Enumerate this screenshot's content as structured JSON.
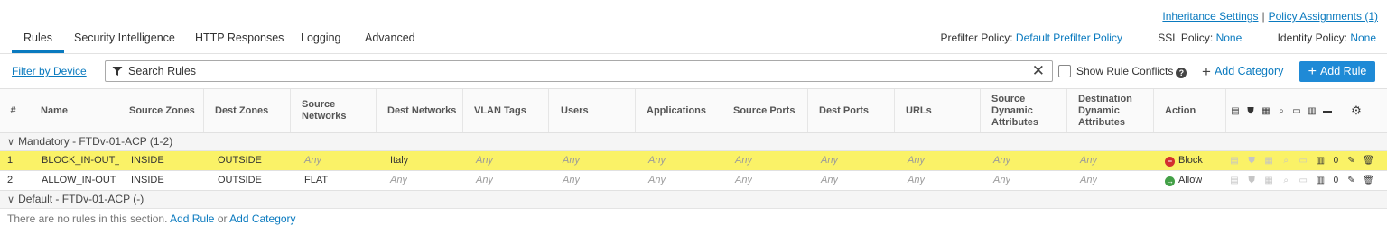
{
  "header_links": {
    "inheritance": "Inheritance Settings",
    "separator": "|",
    "assignments": "Policy Assignments (1)"
  },
  "tabs": [
    {
      "label": "Rules",
      "active": true
    },
    {
      "label": "Security Intelligence",
      "active": false
    },
    {
      "label": "HTTP Responses",
      "active": false
    },
    {
      "label": "Logging",
      "active": false
    },
    {
      "label": "Advanced",
      "active": false
    }
  ],
  "policies": {
    "prefilter_label": "Prefilter Policy:",
    "prefilter_value": "Default Prefilter Policy",
    "ssl_label": "SSL Policy:",
    "ssl_value": "None",
    "identity_label": "Identity Policy:",
    "identity_value": "None"
  },
  "toolbar": {
    "filter_by_device": "Filter by Device",
    "search_placeholder": "Search Rules",
    "show_conflicts": "Show Rule Conflicts",
    "add_category": "Add Category",
    "add_rule": "Add Rule"
  },
  "columns": [
    "#",
    "Name",
    "Source Zones",
    "Dest Zones",
    "Source Networks",
    "Dest Networks",
    "VLAN Tags",
    "Users",
    "Applications",
    "Source Ports",
    "Dest Ports",
    "URLs",
    "Source Dynamic Attributes",
    "Destination Dynamic Attributes",
    "Action"
  ],
  "sections": [
    {
      "title": "Mandatory - FTDv-01-ACP (1-2)",
      "rules": [
        {
          "num": "1",
          "name": "BLOCK_IN-OUT_I",
          "src_zones": "INSIDE",
          "dst_zones": "OUTSIDE",
          "src_networks": "Any",
          "dst_networks": "Italy",
          "vlan": "Any",
          "users": "Any",
          "apps": "Any",
          "src_ports": "Any",
          "dst_ports": "Any",
          "urls": "Any",
          "src_dyn": "Any",
          "dst_dyn": "Any",
          "action": "Block",
          "count": "0",
          "highlighted": true
        },
        {
          "num": "2",
          "name": "ALLOW_IN-OUT",
          "src_zones": "INSIDE",
          "dst_zones": "OUTSIDE",
          "src_networks": "FLAT",
          "dst_networks": "Any",
          "vlan": "Any",
          "users": "Any",
          "apps": "Any",
          "src_ports": "Any",
          "dst_ports": "Any",
          "urls": "Any",
          "src_dyn": "Any",
          "dst_dyn": "Any",
          "action": "Allow",
          "count": "0",
          "highlighted": false
        }
      ]
    },
    {
      "title": "Default - FTDv-01-ACP (-)",
      "empty_text": "There are no rules in this section.",
      "empty_add_rule": "Add Rule",
      "empty_or": "or",
      "empty_add_category": "Add Category"
    }
  ],
  "colors": {
    "accent": "#1f8ad6",
    "link": "#0a7abf",
    "highlight": "#faf267",
    "block": "#d32f2f",
    "allow": "#43a047"
  }
}
